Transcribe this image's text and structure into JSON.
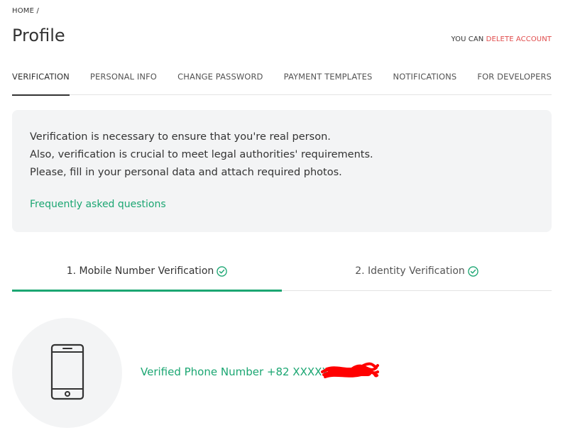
{
  "breadcrumb": {
    "home": "HOME",
    "separator": "/"
  },
  "page": {
    "title": "Profile"
  },
  "account": {
    "prefix": "YOU CAN",
    "delete_label": "DELETE ACCOUNT"
  },
  "tabs": [
    {
      "label": "VERIFICATION",
      "active": true
    },
    {
      "label": "PERSONAL INFO"
    },
    {
      "label": "CHANGE PASSWORD"
    },
    {
      "label": "PAYMENT TEMPLATES"
    },
    {
      "label": "NOTIFICATIONS"
    },
    {
      "label": "FOR DEVELOPERS"
    }
  ],
  "info": {
    "lines": [
      "Verification is necessary to ensure that you're real person.",
      "Also, verification is crucial to meet legal authorities' requirements.",
      "Please, fill in your personal data and attach required photos."
    ],
    "faq_label": "Frequently asked questions"
  },
  "steps": [
    {
      "label": "1. Mobile Number Verification",
      "active": true,
      "icon": "check-circle-icon"
    },
    {
      "label": "2. Identity Verification",
      "icon": "check-circle-icon"
    }
  ],
  "phone": {
    "icon": "smartphone-icon",
    "verified_text": "Verified Phone Number +82 XXXXX"
  },
  "colors": {
    "accent": "#1ba672",
    "danger": "#e04b4b",
    "panel": "#f3f4f5",
    "redaction": "#ff0000"
  }
}
